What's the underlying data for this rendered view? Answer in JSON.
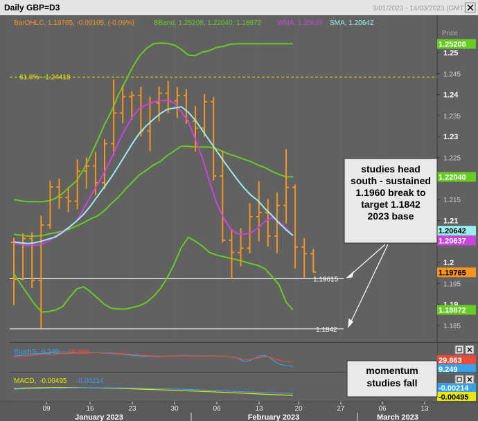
{
  "window": {
    "title": "Daily GBP=D3",
    "date_range": "3/01/2023 - 14/03/2023 (GMT)",
    "close_icon": "close-icon"
  },
  "colors": {
    "background": "#616161",
    "price_bar": "#f7941d",
    "bband": "#66cc22",
    "wma": "#cc44dd",
    "sma": "#99eeee",
    "fib": "#e8e800",
    "stoch_k": "#3aa0e8",
    "stoch_d": "#e84c3a",
    "macd": "#e8e800",
    "macd_signal": "#3aa0e8"
  },
  "legend": {
    "bar": "BarOHLC, 1.19765, -0.00105, (-0.09%)",
    "bband": "BBand, 1.25208, 1.22040, 1.18872",
    "wma": "WMA, 1.20637",
    "sma": "SMA, 1.20642"
  },
  "price_axis_title": "Price",
  "price_tags": [
    {
      "text": "1.25208",
      "value": 1.25208,
      "bg": "#66cc22",
      "fg": "#ffffff"
    },
    {
      "text": "1.22040",
      "value": 1.2204,
      "bg": "#66cc22",
      "fg": "#ffffff"
    },
    {
      "text": "1.20642",
      "value": 1.20642,
      "bg": "#99eeee",
      "fg": "#000000"
    },
    {
      "text": "1.20637",
      "value": 1.20637,
      "bg": "#cc44dd",
      "fg": "#ffffff"
    },
    {
      "text": "1.19765",
      "value": 1.19765,
      "bg": "#f7941d",
      "fg": "#000000"
    },
    {
      "text": "1.18872",
      "value": 1.18872,
      "bg": "#66cc22",
      "fg": "#ffffff"
    }
  ],
  "price_ticks": [
    "1.25",
    "1.245",
    "1.24",
    "1.235",
    "1.23",
    "1.225",
    "1.22",
    "1.215",
    "1.21",
    "1.205",
    "1.2",
    "1.195",
    "1.19",
    "1.185"
  ],
  "fib_label": "61.8% - 1.24418",
  "levels": [
    {
      "label": "1.19615",
      "value": 1.19615
    },
    {
      "label": "1.1842",
      "value": 1.1842
    }
  ],
  "annotations": {
    "main": "studies head south - sustained 1.1960 break to target 1.1842 2023 base",
    "momentum": "momentum studies fall"
  },
  "stoch_panel": {
    "legend_name": "StochS,",
    "k_value": "9.249",
    "d_value": "29.863",
    "tags": [
      {
        "text": "29.863",
        "bg": "#e84c3a",
        "fg": "#ffffff"
      },
      {
        "text": "9.249",
        "bg": "#3aa0e8",
        "fg": "#ffffff"
      }
    ]
  },
  "macd_panel": {
    "legend_name": "MACD,",
    "macd_value": "-0.00495",
    "signal_value": "-0.00214",
    "tags": [
      {
        "text": "-0.00214",
        "bg": "#3aa0e8",
        "fg": "#ffffff"
      },
      {
        "text": "-0.00495",
        "bg": "#e8e800",
        "fg": "#000000"
      }
    ]
  },
  "x_axis": {
    "day_ticks": [
      "09",
      "16",
      "23",
      "30",
      "06",
      "13",
      "20",
      "27",
      "06",
      "13"
    ],
    "months": [
      "January 2023",
      "February 2023",
      "March 2023"
    ]
  },
  "chart_data": [
    {
      "type": "ohlc",
      "title": "Daily GBP=D3",
      "ylim": [
        1.182,
        1.2555
      ],
      "dates": [
        "2023-01-03",
        "2023-01-04",
        "2023-01-05",
        "2023-01-06",
        "2023-01-09",
        "2023-01-10",
        "2023-01-11",
        "2023-01-12",
        "2023-01-13",
        "2023-01-16",
        "2023-01-17",
        "2023-01-18",
        "2023-01-19",
        "2023-01-20",
        "2023-01-23",
        "2023-01-24",
        "2023-01-25",
        "2023-01-26",
        "2023-01-27",
        "2023-01-30",
        "2023-01-31",
        "2023-02-01",
        "2023-02-02",
        "2023-02-03",
        "2023-02-06",
        "2023-02-07",
        "2023-02-08",
        "2023-02-09",
        "2023-02-10",
        "2023-02-13",
        "2023-02-14",
        "2023-02-15",
        "2023-02-16",
        "2023-02-17"
      ],
      "bars": [
        {
          "o": 1.2048,
          "h": 1.2059,
          "l": 1.1899,
          "c": 1.196
        },
        {
          "o": 1.196,
          "h": 1.2069,
          "l": 1.1958,
          "c": 1.2057
        },
        {
          "o": 1.2057,
          "h": 1.2072,
          "l": 1.1939,
          "c": 1.1957
        },
        {
          "o": 1.1957,
          "h": 1.2112,
          "l": 1.1843,
          "c": 1.2089
        },
        {
          "o": 1.2089,
          "h": 1.2195,
          "l": 1.208,
          "c": 1.218
        },
        {
          "o": 1.218,
          "h": 1.22,
          "l": 1.2128,
          "c": 1.2155
        },
        {
          "o": 1.2155,
          "h": 1.2179,
          "l": 1.212,
          "c": 1.2146
        },
        {
          "o": 1.2146,
          "h": 1.2246,
          "l": 1.2127,
          "c": 1.2218
        },
        {
          "o": 1.2218,
          "h": 1.225,
          "l": 1.2176,
          "c": 1.223
        },
        {
          "o": 1.223,
          "h": 1.2263,
          "l": 1.216,
          "c": 1.219
        },
        {
          "o": 1.219,
          "h": 1.2294,
          "l": 1.2175,
          "c": 1.2283
        },
        {
          "o": 1.2283,
          "h": 1.2436,
          "l": 1.2255,
          "c": 1.2356
        },
        {
          "o": 1.2356,
          "h": 1.2422,
          "l": 1.2332,
          "c": 1.2395
        },
        {
          "o": 1.2395,
          "h": 1.2408,
          "l": 1.234,
          "c": 1.2398
        },
        {
          "o": 1.2398,
          "h": 1.2419,
          "l": 1.23,
          "c": 1.2313
        },
        {
          "o": 1.2313,
          "h": 1.2395,
          "l": 1.2265,
          "c": 1.238
        },
        {
          "o": 1.238,
          "h": 1.2419,
          "l": 1.2336,
          "c": 1.2403
        },
        {
          "o": 1.2403,
          "h": 1.2433,
          "l": 1.2356,
          "c": 1.2385
        },
        {
          "o": 1.2385,
          "h": 1.2418,
          "l": 1.2344,
          "c": 1.2398
        },
        {
          "o": 1.2398,
          "h": 1.2413,
          "l": 1.233,
          "c": 1.2337
        },
        {
          "o": 1.2337,
          "h": 1.2373,
          "l": 1.2264,
          "c": 1.232
        },
        {
          "o": 1.232,
          "h": 1.2401,
          "l": 1.2299,
          "c": 1.2383
        },
        {
          "o": 1.2383,
          "h": 1.2394,
          "l": 1.2195,
          "c": 1.2206
        },
        {
          "o": 1.2206,
          "h": 1.2267,
          "l": 1.2047,
          "c": 1.2053
        },
        {
          "o": 1.2053,
          "h": 1.208,
          "l": 1.196,
          "c": 1.2024
        },
        {
          "o": 1.2024,
          "h": 1.2082,
          "l": 1.1991,
          "c": 1.2034
        },
        {
          "o": 1.2034,
          "h": 1.2141,
          "l": 1.2022,
          "c": 1.2109
        },
        {
          "o": 1.2109,
          "h": 1.2194,
          "l": 1.205,
          "c": 1.2119
        },
        {
          "o": 1.2119,
          "h": 1.2151,
          "l": 1.2038,
          "c": 1.2063
        },
        {
          "o": 1.2063,
          "h": 1.2167,
          "l": 1.2022,
          "c": 1.2136
        },
        {
          "o": 1.2136,
          "h": 1.227,
          "l": 1.2093,
          "c": 1.2179
        },
        {
          "o": 1.2179,
          "h": 1.2186,
          "l": 1.1986,
          "c": 1.2037
        },
        {
          "o": 1.2037,
          "h": 1.2058,
          "l": 1.1964,
          "c": 1.2021
        },
        {
          "o": 1.2021,
          "h": 1.2032,
          "l": 1.1976,
          "c": 1.1977
        }
      ],
      "series": [
        {
          "name": "SMA",
          "values": [
            1.2049,
            1.2047,
            1.2045,
            1.2047,
            1.2051,
            1.2056,
            1.2061,
            1.2072,
            1.2085,
            1.2099,
            1.2115,
            1.2135,
            1.2158,
            1.2181,
            1.2204,
            1.223,
            1.2257,
            1.2284,
            1.2308,
            1.2326,
            1.2341,
            1.2355,
            1.2365,
            1.2368,
            1.2371,
            1.2358,
            1.2339,
            1.2315,
            1.2291,
            1.2267,
            1.2243,
            1.222,
            1.2198,
            1.2177,
            1.216,
            1.2147,
            1.2128,
            1.2112,
            1.2094,
            1.2078,
            1.2064
          ]
        },
        {
          "name": "WMA",
          "values": [
            1.2046,
            1.2043,
            1.204,
            1.2041,
            1.2043,
            1.2052,
            1.2064,
            1.2074,
            1.2086,
            1.2099,
            1.2128,
            1.2158,
            1.2186,
            1.2216,
            1.2249,
            1.2286,
            1.2319,
            1.2347,
            1.2367,
            1.2376,
            1.2382,
            1.2386,
            1.2386,
            1.238,
            1.2359,
            1.2335,
            1.2294,
            1.2249,
            1.2195,
            1.2144,
            1.2108,
            1.2081,
            1.2069,
            1.2067,
            1.2071,
            1.2082,
            1.2098,
            1.2107,
            1.2097,
            1.2082,
            1.2064
          ]
        },
        {
          "name": "BBand upper",
          "values": [
            1.215,
            1.2147,
            1.2145,
            1.2145,
            1.2145,
            1.2147,
            1.2153,
            1.2165,
            1.218,
            1.2195,
            1.2222,
            1.2255,
            1.2291,
            1.2329,
            1.2361,
            1.24,
            1.2432,
            1.2465,
            1.2492,
            1.251,
            1.2521,
            1.2523,
            1.2522,
            1.2518,
            1.2508,
            1.2494,
            1.2493,
            1.2501,
            1.2505,
            1.2512,
            1.2515,
            1.252,
            1.2521,
            1.2521,
            1.2521,
            1.2521,
            1.2521,
            1.2521,
            1.2521,
            1.2521,
            1.2521
          ]
        },
        {
          "name": "BBand middle",
          "values": [
            1.2067,
            1.2065,
            1.2063,
            1.2063,
            1.2064,
            1.2068,
            1.2071,
            1.2075,
            1.208,
            1.2087,
            1.2095,
            1.2104,
            1.2111,
            1.2124,
            1.2141,
            1.2156,
            1.2175,
            1.2192,
            1.2209,
            1.222,
            1.2232,
            1.2241,
            1.2255,
            1.2266,
            1.2277,
            1.2277,
            1.2275,
            1.2275,
            1.2275,
            1.2271,
            1.2264,
            1.2257,
            1.2252,
            1.2246,
            1.224,
            1.2232,
            1.2226,
            1.2217,
            1.221,
            1.2204,
            1.2204
          ]
        },
        {
          "name": "BBand lower",
          "values": [
            1.1973,
            1.1948,
            1.1924,
            1.19,
            1.1882,
            1.1883,
            1.1887,
            1.1895,
            1.1917,
            1.1937,
            1.1942,
            1.193,
            1.1915,
            1.19,
            1.1891,
            1.1889,
            1.1889,
            1.1893,
            1.1897,
            1.1905,
            1.1919,
            1.1938,
            1.1964,
            1.1997,
            1.2036,
            1.206,
            1.2051,
            1.2039,
            1.2024,
            1.2018,
            1.2014,
            1.201,
            1.2006,
            1.2002,
            1.1997,
            1.1993,
            1.1985,
            1.1966,
            1.1947,
            1.1906,
            1.1887
          ]
        }
      ],
      "levels": [
        {
          "name": "61.8%",
          "value": 1.24418
        },
        {
          "value": 1.19615
        },
        {
          "value": 1.1842
        }
      ]
    },
    {
      "type": "line",
      "title": "StochS",
      "ylim": [
        0,
        100
      ],
      "series": [
        {
          "name": "%K",
          "values": [
            55,
            58,
            60,
            62,
            65,
            66,
            68,
            70,
            72,
            74,
            74,
            74,
            73,
            71,
            70,
            72,
            72,
            71,
            70,
            68,
            68,
            66,
            65,
            63,
            60,
            58,
            57,
            55,
            55,
            54,
            53,
            54,
            55,
            56,
            57,
            58,
            57,
            56,
            55,
            56,
            56,
            57,
            55,
            54,
            53,
            52,
            50,
            40,
            30,
            35,
            45,
            55,
            58,
            50,
            35,
            20,
            15,
            12,
            9.249
          ]
        },
        {
          "name": "%D",
          "values": [
            50,
            52,
            54,
            56,
            58,
            60,
            61,
            62,
            63,
            65,
            66,
            67,
            68,
            69,
            70,
            71,
            72,
            72,
            71,
            70,
            70,
            69,
            67,
            66,
            64,
            62,
            60,
            58,
            57,
            56,
            55,
            55,
            55,
            56,
            56,
            57,
            56,
            55,
            55,
            55,
            55,
            56,
            55,
            54,
            53,
            52,
            49,
            44,
            40,
            40,
            44,
            48,
            52,
            52,
            45,
            37,
            32,
            30,
            29.863
          ]
        }
      ]
    },
    {
      "type": "line",
      "title": "MACD",
      "series": [
        {
          "name": "MACD",
          "values": [
            0.005,
            0.0055,
            0.0058,
            0.006,
            0.0062,
            0.0063,
            0.0064,
            0.0063,
            0.0062,
            0.006,
            0.0058,
            0.0055,
            0.0052,
            0.0048,
            0.0044,
            0.004,
            0.0036,
            0.0032,
            0.0028,
            0.0023,
            0.0018,
            0.0013,
            0.0008,
            0.0003,
            -0.0002,
            -0.0007,
            -0.0012,
            -0.0018,
            -0.0024,
            -0.003,
            -0.0036,
            -0.0041,
            -0.0045,
            -0.00495
          ]
        },
        {
          "name": "Signal",
          "values": [
            0.004,
            0.0043,
            0.0046,
            0.0049,
            0.0052,
            0.0054,
            0.0056,
            0.0058,
            0.0059,
            0.006,
            0.006,
            0.006,
            0.0059,
            0.0058,
            0.0056,
            0.0054,
            0.0052,
            0.0049,
            0.0046,
            0.0042,
            0.0038,
            0.0034,
            0.0029,
            0.0024,
            0.0019,
            0.0013,
            0.0008,
            0.0003,
            -0.0002,
            -0.0007,
            -0.0011,
            -0.0015,
            -0.0018,
            -0.00214
          ]
        }
      ]
    }
  ]
}
